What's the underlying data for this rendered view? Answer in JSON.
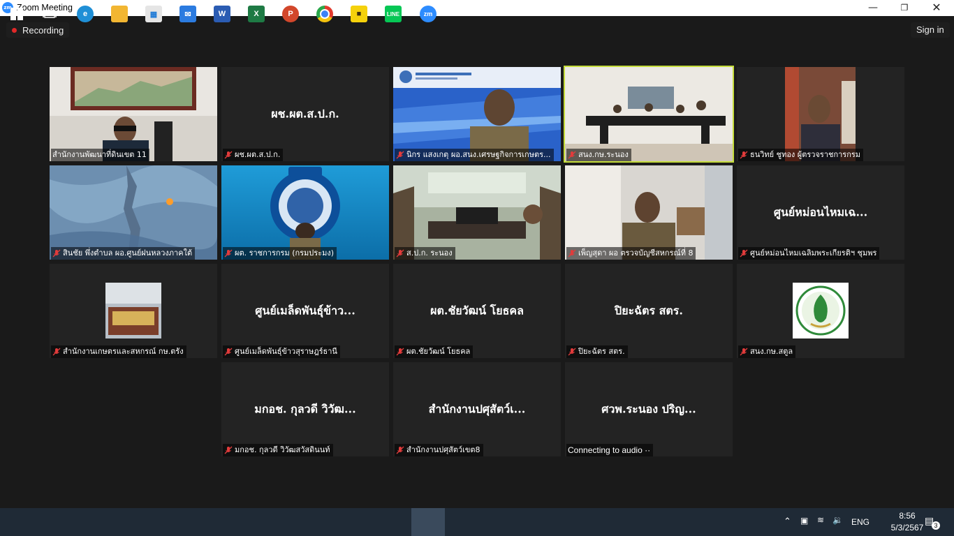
{
  "window": {
    "title": "Zoom Meeting",
    "logo": "zm"
  },
  "topbar": {
    "recording_label": "Recording",
    "signin_label": "Sign in"
  },
  "tiles": [
    {
      "name": "สำนักงานพัฒนาที่ดินเขต 11",
      "big": "",
      "video": "map-wall",
      "muted": false
    },
    {
      "name": "ผช.ผต.ส.ป.ก.",
      "big": "ผช.ผต.ส.ป.ก.",
      "video": "",
      "muted": true
    },
    {
      "name": "นิกร แสงเกตุ ผอ.สนง.เศรษฐกิจการเกษตร...",
      "big": "",
      "video": "blue-bg",
      "muted": true
    },
    {
      "name": "สนง.กษ.ระนอง",
      "big": "",
      "video": "meeting-room",
      "muted": true
    },
    {
      "name": "ธนวิทย์ ชูทอง ผู้ตรวจราชการกรม",
      "big": "",
      "video": "office",
      "muted": true
    },
    {
      "name": "สินชัย พึ่งตำบล ผอ.ศูนย์ฝนหลวงภาคใต้",
      "big": "",
      "video": "radar",
      "muted": true
    },
    {
      "name": "ผต. ราชการกรม (กรมประมง)",
      "big": "",
      "video": "fisheries",
      "muted": true
    },
    {
      "name": "ส.ป.ก. ระนอง",
      "big": "",
      "video": "alro",
      "muted": true
    },
    {
      "name": "เพ็ญสุดา ผอ ตรวจบัญชีสหกรณ์ที่ 8",
      "big": "",
      "video": "office2",
      "muted": true
    },
    {
      "name": "ศูนย์หม่อนไหมเฉลิมพระเกียรติฯ ชุมพร",
      "big": "ศูนย์หม่อนไหมเฉ...",
      "video": "",
      "muted": true
    },
    {
      "name": "สำนักงานเกษตรและสหกรณ์ กษ.ตรัง",
      "big": "",
      "video": "avatar-photo",
      "muted": true
    },
    {
      "name": "ศูนย์เมล็ดพันธุ์ข้าวสุราษฎร์ธานี",
      "big": "ศูนย์เมล็ดพันธุ์ข้าว...",
      "video": "",
      "muted": true
    },
    {
      "name": "ผต.ชัยวัฒน์ โยธคล",
      "big": "ผต.ชัยวัฒน์ โยธคล",
      "video": "",
      "muted": true
    },
    {
      "name": "ปิยะฉัตร สตร.",
      "big": "ปิยะฉัตร สตร.",
      "video": "",
      "muted": true
    },
    {
      "name": "สนง.กษ.สตูล",
      "big": "",
      "video": "avatar-logo",
      "muted": true
    },
    {
      "name": "มกอช. กุลวดี วิวัฒสวัสดินนท์",
      "big": "มกอช. กุลวดี วิวัฒ...",
      "video": "",
      "muted": true
    },
    {
      "name": "สำนักงานปศุสัตว์เขต8",
      "big": "สำนักงานปศุสัตว์เ...",
      "video": "",
      "muted": true
    },
    {
      "name": "Connecting to audio ··",
      "big": "ศวพ.ระนอง ปริญ...",
      "video": "",
      "muted": false
    }
  ],
  "taskbar": {
    "apps": [
      "windows-start",
      "task-view",
      "edge",
      "file-explorer",
      "store",
      "mail",
      "word",
      "excel",
      "powerpoint",
      "chrome",
      "kakaotalk",
      "line",
      "zoom"
    ],
    "language": "ENG",
    "time": "8:56",
    "date": "5/3/2567",
    "notification_count": "3"
  }
}
